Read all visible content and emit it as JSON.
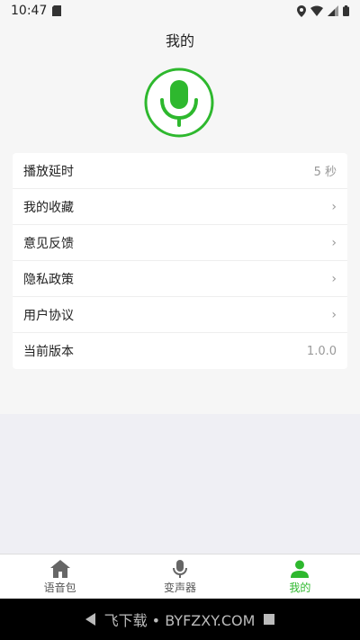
{
  "status_bar": {
    "time": "10:47",
    "icons": [
      "sd-card-icon",
      "location-icon",
      "wifi-icon",
      "signal-icon",
      "battery-icon"
    ]
  },
  "page": {
    "title": "我的"
  },
  "colors": {
    "accent": "#2eb82e"
  },
  "settings": {
    "rows": [
      {
        "label": "播放延时",
        "value": "5 秒"
      },
      {
        "label": "我的收藏",
        "value": ""
      },
      {
        "label": "意见反馈",
        "value": ""
      },
      {
        "label": "隐私政策",
        "value": ""
      },
      {
        "label": "用户协议",
        "value": ""
      },
      {
        "label": "当前版本",
        "value": "1.0.0"
      }
    ]
  },
  "tabbar": {
    "tabs": [
      {
        "label": "语音包",
        "icon": "home-icon",
        "active": false
      },
      {
        "label": "变声器",
        "icon": "microphone-icon",
        "active": false
      },
      {
        "label": "我的",
        "icon": "person-icon",
        "active": true
      }
    ]
  },
  "watermark": {
    "text": "飞下载 • BYFZXY.COM"
  }
}
